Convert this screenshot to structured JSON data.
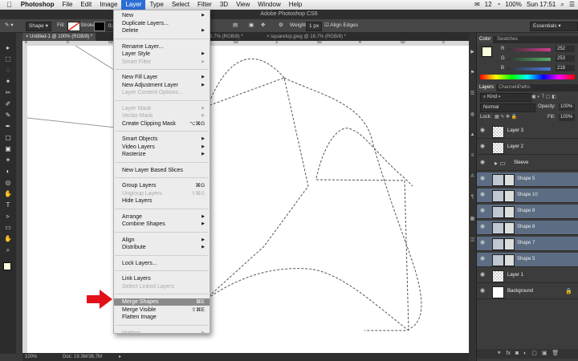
{
  "menubar": {
    "apple": "",
    "items": [
      "Photoshop",
      "File",
      "Edit",
      "Image",
      "Layer",
      "Type",
      "Select",
      "Filter",
      "3D",
      "View",
      "Window",
      "Help"
    ],
    "active_index": 4,
    "status_num": "12",
    "battery": "100%",
    "clock": "Sun 17:51"
  },
  "window": {
    "title": "Adobe Photoshop CS6"
  },
  "options": {
    "tool_mode": "Shape",
    "fill_label": "Fill:",
    "stroke_label": "Stroke:",
    "stroke_size": "0.5",
    "weight_label": "Weight:",
    "weight_value": "1 px",
    "align_edges": "Align Edges",
    "workspace": "Essentials"
  },
  "tabs": [
    {
      "label": "Untitled-1 @ 100% (RGB/8) *",
      "active": true
    },
    {
      "label": "ipeg @ 16.7% (RGB/8) *",
      "active": false
    },
    {
      "label": "squaretop.jpeg @ 16.7% (RGB/8) *",
      "active": false
    }
  ],
  "ruler_ticks": [
    "8",
    "0",
    "50",
    "1",
    "2",
    "50",
    "3",
    "50",
    "4",
    "50",
    "5"
  ],
  "status": {
    "zoom": "100%",
    "doc": "Doc: 19.3M/36.7M"
  },
  "tools": [
    "▸",
    "⬚",
    "◌",
    "✦",
    "✂",
    "✐",
    "✎",
    "✒",
    "▢",
    "▣",
    "✶",
    "◐",
    "◎",
    "✋",
    "T",
    "▹",
    "▭",
    "✋",
    "⌕"
  ],
  "layer_menu": {
    "groups": [
      [
        {
          "label": "New",
          "submenu": true
        },
        {
          "label": "Duplicate Layers...",
          "submenu": false
        },
        {
          "label": "Delete",
          "submenu": true
        }
      ],
      [
        {
          "label": "Rename Layer...",
          "submenu": false
        },
        {
          "label": "Layer Style",
          "submenu": true
        },
        {
          "label": "Smart Filter",
          "submenu": true,
          "disabled": true
        }
      ],
      [
        {
          "label": "New Fill Layer",
          "submenu": true
        },
        {
          "label": "New Adjustment Layer",
          "submenu": true
        },
        {
          "label": "Layer Content Options...",
          "disabled": true
        }
      ],
      [
        {
          "label": "Layer Mask",
          "submenu": true,
          "disabled": true
        },
        {
          "label": "Vector Mask",
          "submenu": true,
          "disabled": true
        },
        {
          "label": "Create Clipping Mask",
          "shortcut": "⌥⌘G"
        }
      ],
      [
        {
          "label": "Smart Objects",
          "submenu": true
        },
        {
          "label": "Video Layers",
          "submenu": true
        },
        {
          "label": "Rasterize",
          "submenu": true
        }
      ],
      [
        {
          "label": "New Layer Based Slices"
        }
      ],
      [
        {
          "label": "Group Layers",
          "shortcut": "⌘G"
        },
        {
          "label": "Ungroup Layers",
          "shortcut": "⇧⌘G",
          "disabled": true
        },
        {
          "label": "Hide Layers"
        }
      ],
      [
        {
          "label": "Arrange",
          "submenu": true
        },
        {
          "label": "Combine Shapes",
          "submenu": true
        }
      ],
      [
        {
          "label": "Align",
          "submenu": true
        },
        {
          "label": "Distribute",
          "submenu": true
        }
      ],
      [
        {
          "label": "Lock Layers..."
        }
      ],
      [
        {
          "label": "Link Layers"
        },
        {
          "label": "Select Linked Layers",
          "disabled": true
        }
      ],
      [
        {
          "label": "Merge Shapes",
          "shortcut": "⌘E",
          "highlight": true
        },
        {
          "label": "Merge Visible",
          "shortcut": "⇧⌘E"
        },
        {
          "label": "Flatten Image"
        }
      ],
      [
        {
          "label": "Matting",
          "submenu": true,
          "disabled": true
        }
      ]
    ]
  },
  "color_panel": {
    "tabs": [
      "Color",
      "Swatches"
    ],
    "channels": [
      {
        "name": "R",
        "value": "252",
        "color": "#d23c8c"
      },
      {
        "name": "G",
        "value": "253",
        "color": "#52b36b"
      },
      {
        "name": "B",
        "value": "218",
        "color": "#4a7ad8"
      }
    ],
    "swatch": "#fcfdda"
  },
  "layers_panel": {
    "tabs": [
      "Layers",
      "Channels",
      "Paths"
    ],
    "kind": "Kind",
    "blend": "Normal",
    "opacity_label": "Opacity:",
    "opacity": "100%",
    "lock_label": "Lock:",
    "fill_label": "Fill:",
    "fill": "100%",
    "layers": [
      {
        "name": "Layer 3",
        "selected": false,
        "thumb": "checker"
      },
      {
        "name": "Layer 2",
        "selected": false,
        "thumb": "checker"
      },
      {
        "name": "Sleeve",
        "selected": false,
        "thumb": "folder"
      },
      {
        "name": "Shape 5",
        "selected": true,
        "thumb": "shape"
      },
      {
        "name": "Shape 10",
        "selected": true,
        "thumb": "shape"
      },
      {
        "name": "Shape 8",
        "selected": true,
        "thumb": "shape"
      },
      {
        "name": "Shape 8",
        "selected": true,
        "thumb": "shape"
      },
      {
        "name": "Shape 7",
        "selected": true,
        "thumb": "shape"
      },
      {
        "name": "Shape 5",
        "selected": true,
        "thumb": "shape"
      },
      {
        "name": "Layer 1",
        "selected": false,
        "thumb": "checker"
      },
      {
        "name": "Background",
        "selected": false,
        "thumb": "white"
      }
    ]
  }
}
